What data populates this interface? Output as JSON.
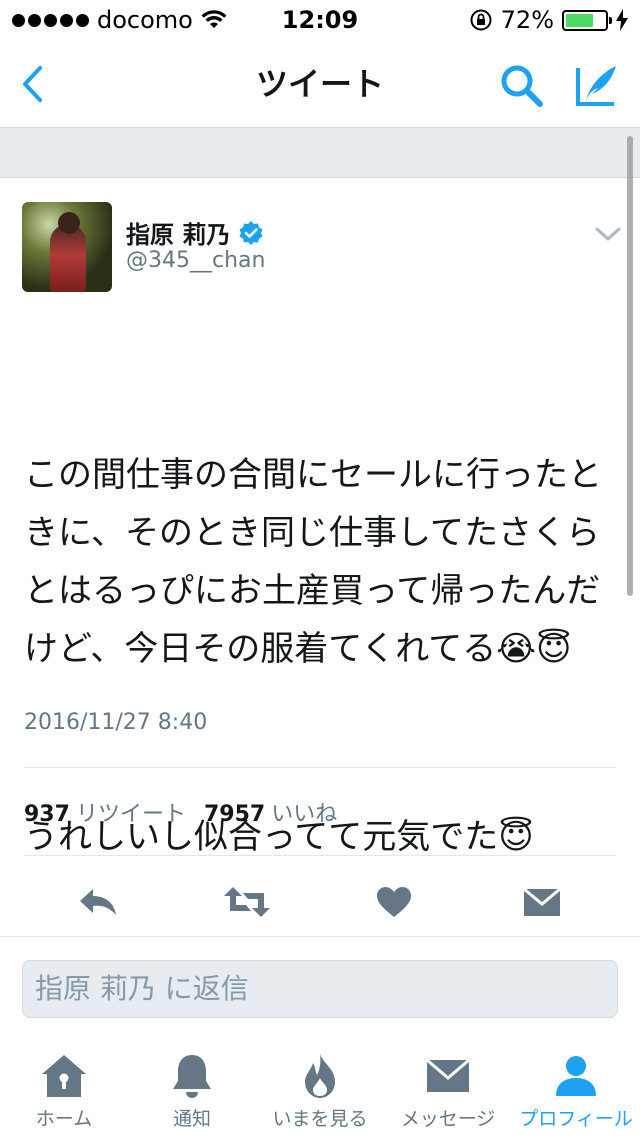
{
  "status_bar": {
    "carrier": "docomo",
    "time": "12:09",
    "battery_percent": "72%",
    "battery_level": 0.72
  },
  "nav": {
    "title": "ツイート"
  },
  "tweet": {
    "display_name": "指原 莉乃",
    "handle": "@345__chan",
    "text_line1": "この間仕事の合間にセールに行ったときに、そのとき同じ仕事してたさくらとはるっぴにお土産買って帰ったんだけど、今日その服着てくれてる😭😇",
    "text_line2": "うれしいし似合ってて元気でた😇",
    "timestamp": "2016/11/27 8:40",
    "retweet_count": "937",
    "retweet_label": "リツイート",
    "like_count": "7957",
    "like_label": "いいね"
  },
  "reply": {
    "placeholder": "指原 莉乃 に返信"
  },
  "tab_bar": {
    "items": [
      {
        "label": "ホーム",
        "icon": "home-icon"
      },
      {
        "label": "通知",
        "icon": "bell-icon"
      },
      {
        "label": "いまを見る",
        "icon": "flame-icon"
      },
      {
        "label": "メッセージ",
        "icon": "envelope-icon"
      },
      {
        "label": "プロフィール",
        "icon": "person-icon"
      }
    ],
    "active_index": 4
  },
  "colors": {
    "accent": "#1da1f2",
    "icon_gray": "#657786",
    "background_gray": "#e6ecf0"
  }
}
